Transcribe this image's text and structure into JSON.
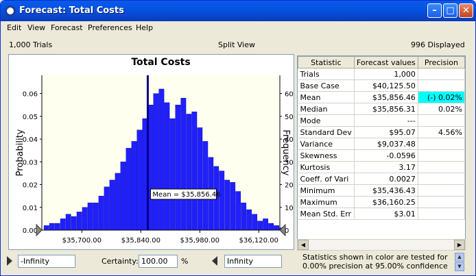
{
  "window": {
    "title": "Forecast: Total Costs"
  },
  "menu": [
    "Edit",
    "View",
    "Forecast",
    "Preferences",
    "Help"
  ],
  "status": {
    "trials": "1,000 Trials",
    "view_mode": "Split View",
    "displayed": "996 Displayed"
  },
  "chart_data": {
    "type": "bar",
    "title": "Total Costs",
    "ylabel": "Probability",
    "ylabel_right": "Frequency",
    "x_ticks": [
      "$35,700.00",
      "$35,840.00",
      "$35,980.00",
      "$36,120.00"
    ],
    "x_tick_values": [
      35700,
      35840,
      35980,
      36120
    ],
    "xlim": [
      35605,
      36170
    ],
    "y_ticks": [
      "0.00",
      "0.01",
      "0.02",
      "0.03",
      "0.04",
      "0.05",
      "0.06"
    ],
    "ylim": [
      0,
      0.068
    ],
    "y_right_ticks": [
      "0",
      "10",
      "20",
      "30",
      "40",
      "50",
      "60"
    ],
    "bin_start": 35610,
    "bin_width": 13,
    "values": [
      0.002,
      0.003,
      0.003,
      0.005,
      0.007,
      0.006,
      0.008,
      0.01,
      0.012,
      0.012,
      0.015,
      0.019,
      0.022,
      0.025,
      0.03,
      0.036,
      0.039,
      0.044,
      0.049,
      0.055,
      0.06,
      0.062,
      0.056,
      0.049,
      0.055,
      0.058,
      0.051,
      0.052,
      0.045,
      0.039,
      0.032,
      0.028,
      0.026,
      0.022,
      0.021,
      0.017,
      0.012,
      0.009,
      0.007,
      0.004,
      0.005,
      0.003,
      0.002,
      0.001
    ],
    "mean_value": 35856.46,
    "mean_label": "Mean = $35,856.46",
    "grid": false
  },
  "stats": {
    "headers": [
      "Statistic",
      "Forecast values",
      "Precision"
    ],
    "rows": [
      {
        "name": "Trials",
        "value": "1,000",
        "precision": ""
      },
      {
        "name": "Base Case",
        "value": "$40,125.50",
        "precision": ""
      },
      {
        "name": "Mean",
        "value": "$35,856.46",
        "precision": "(-) 0.02%"
      },
      {
        "name": "Median",
        "value": "$35,856.31",
        "precision": "0.02%"
      },
      {
        "name": "Mode",
        "value": "---",
        "precision": ""
      },
      {
        "name": "Standard Dev",
        "value": "$95.07",
        "precision": "4.56%"
      },
      {
        "name": "Variance",
        "value": "$9,037.48",
        "precision": ""
      },
      {
        "name": "Skewness",
        "value": "-0.0596",
        "precision": ""
      },
      {
        "name": "Kurtosis",
        "value": "3.17",
        "precision": ""
      },
      {
        "name": "Coeff. of Vari",
        "value": "0.0027",
        "precision": ""
      },
      {
        "name": "Minimum",
        "value": "$35,436.43",
        "precision": ""
      },
      {
        "name": "Maximum",
        "value": "$36,160.25",
        "precision": ""
      },
      {
        "name": "Mean Std. Err",
        "value": "$3.01",
        "precision": ""
      }
    ],
    "highlight_color": "#00ffff"
  },
  "bottom": {
    "left_value": "-Infinity",
    "certainty_label": "Certainty:",
    "certainty_value": "100.00",
    "certainty_unit": "%",
    "right_value": "Infinity",
    "note": "Statistics shown in color are tested for 0.00% precision at 95.00% confidence"
  },
  "colors": {
    "bar": "#2020ff",
    "mean_line": "#000080",
    "plot_bg": "#fffff0"
  }
}
